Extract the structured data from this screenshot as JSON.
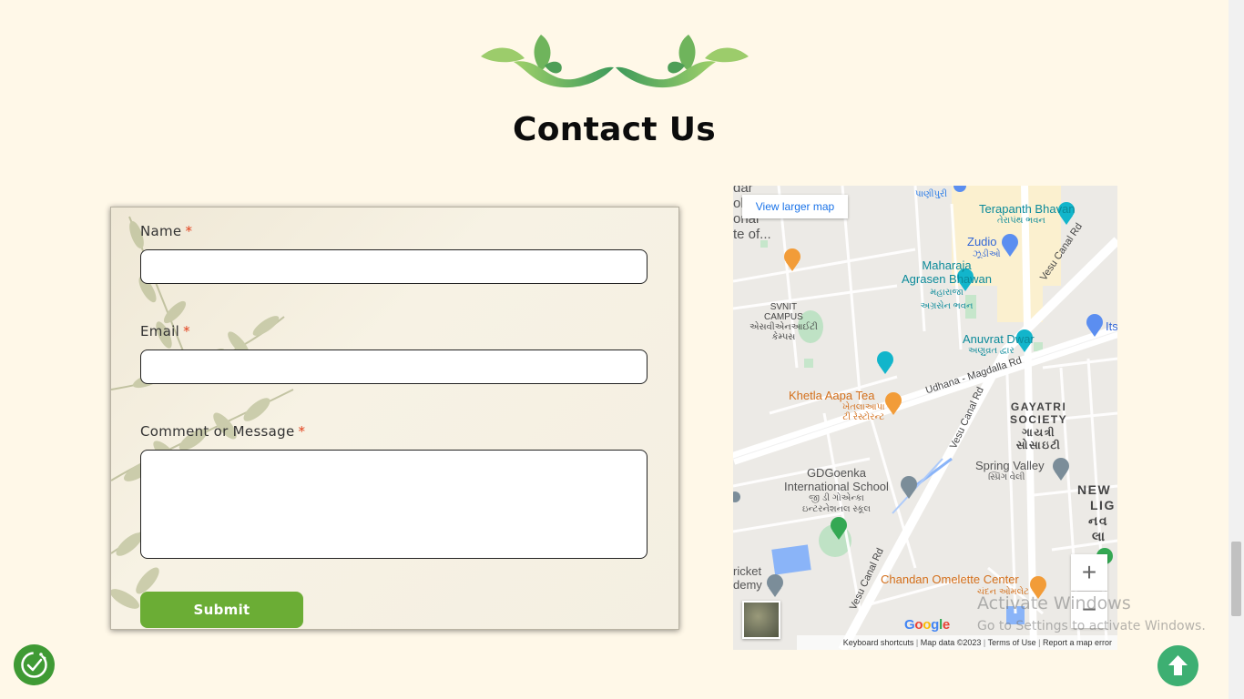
{
  "page": {
    "title": "Contact Us"
  },
  "form": {
    "name_label": "Name",
    "email_label": "Email",
    "message_label": "Comment or Message",
    "required_mark": "*",
    "name_value": "",
    "email_value": "",
    "message_value": "",
    "submit_label": "Submit"
  },
  "map": {
    "larger_map_link": "View larger map",
    "zoom_in": "+",
    "zoom_out": "−",
    "google_logo": "Google",
    "footer": {
      "shortcuts": "Keyboard shortcuts",
      "data": "Map data ©2023",
      "terms": "Terms of Use",
      "report": "Report a map error"
    },
    "labels": {
      "terapanth": "Terapanth Bhavan",
      "terapanth_gu": "તેરાપંથ ભવન",
      "zudio": "Zudio",
      "zudio_gu": "ઝૂડીઓ",
      "maharaja_1": "Maharaja",
      "maharaja_2": "Agrasen Bhawan",
      "maharaja_gu1": "મહારાજા",
      "maharaja_gu2": "અગ્રસેન ભવન",
      "svnit_1": "SVNIT",
      "svnit_2": "CAMPUS",
      "svnit_gu1": "એસવીએનઆઈટી",
      "svnit_gu2": "કેમ્પસ",
      "anuvrat": "Anuvrat Dwar",
      "anuvrat_gu": "અણુવ્રત દ્વાર",
      "vesu_canal_top": "Vesu Canal Rd",
      "vesu_canal_mid": "Vesu Canal Rd",
      "vesu_canal_bottom": "Vesu Canal Rd",
      "udhana": "Udhana - Magdalla Rd",
      "khetla": "Khetla Aapa Tea",
      "khetla_gu1": "ખેતલાઆપા",
      "khetla_gu2": "ટી રેસ્ટોરન્ટ",
      "gayatri_1": "GAYATRI",
      "gayatri_2": "SOCIETY",
      "gayatri_gu1": "ગાયત્રી",
      "gayatri_gu2": "સોસાઇટી",
      "spring": "Spring Valley",
      "spring_gu": "સ્પ્રિંગ વેલી",
      "gdgoenka_1": "GDGoenka",
      "gdgoenka_2": "International School",
      "gdgoenka_gu1": "જી ડી ગોએન્કા",
      "gdgoenka_gu2": "ઇન્ટરનેશનલ સ્કૂલ",
      "chandan": "Chandan Omelette Center",
      "chandan_gu": "ચંદન ઓમલેટ",
      "new": "NEW",
      "lig": "LIG",
      "nava_gu": "નવ",
      "la_gu": "લા",
      "its": "Its",
      "cricket_1": "ricket",
      "cricket_2": "demy",
      "top_left_1": "dar",
      "top_left_2": "ohar",
      "top_left_3": "onal",
      "top_left_4": "te of...",
      "panipuri": "પાણીપુરી"
    }
  },
  "watermark": {
    "line1": "Activate Windows",
    "line2": "Go to Settings to activate Windows."
  },
  "colors": {
    "background": "#fff8e8",
    "submit": "#6bad35",
    "scroll_top": "#3daf72",
    "accent_required": "#e2401c"
  },
  "icons": {
    "scroll_top": "arrow-up-icon",
    "cookie": "cookie-consent-icon"
  }
}
